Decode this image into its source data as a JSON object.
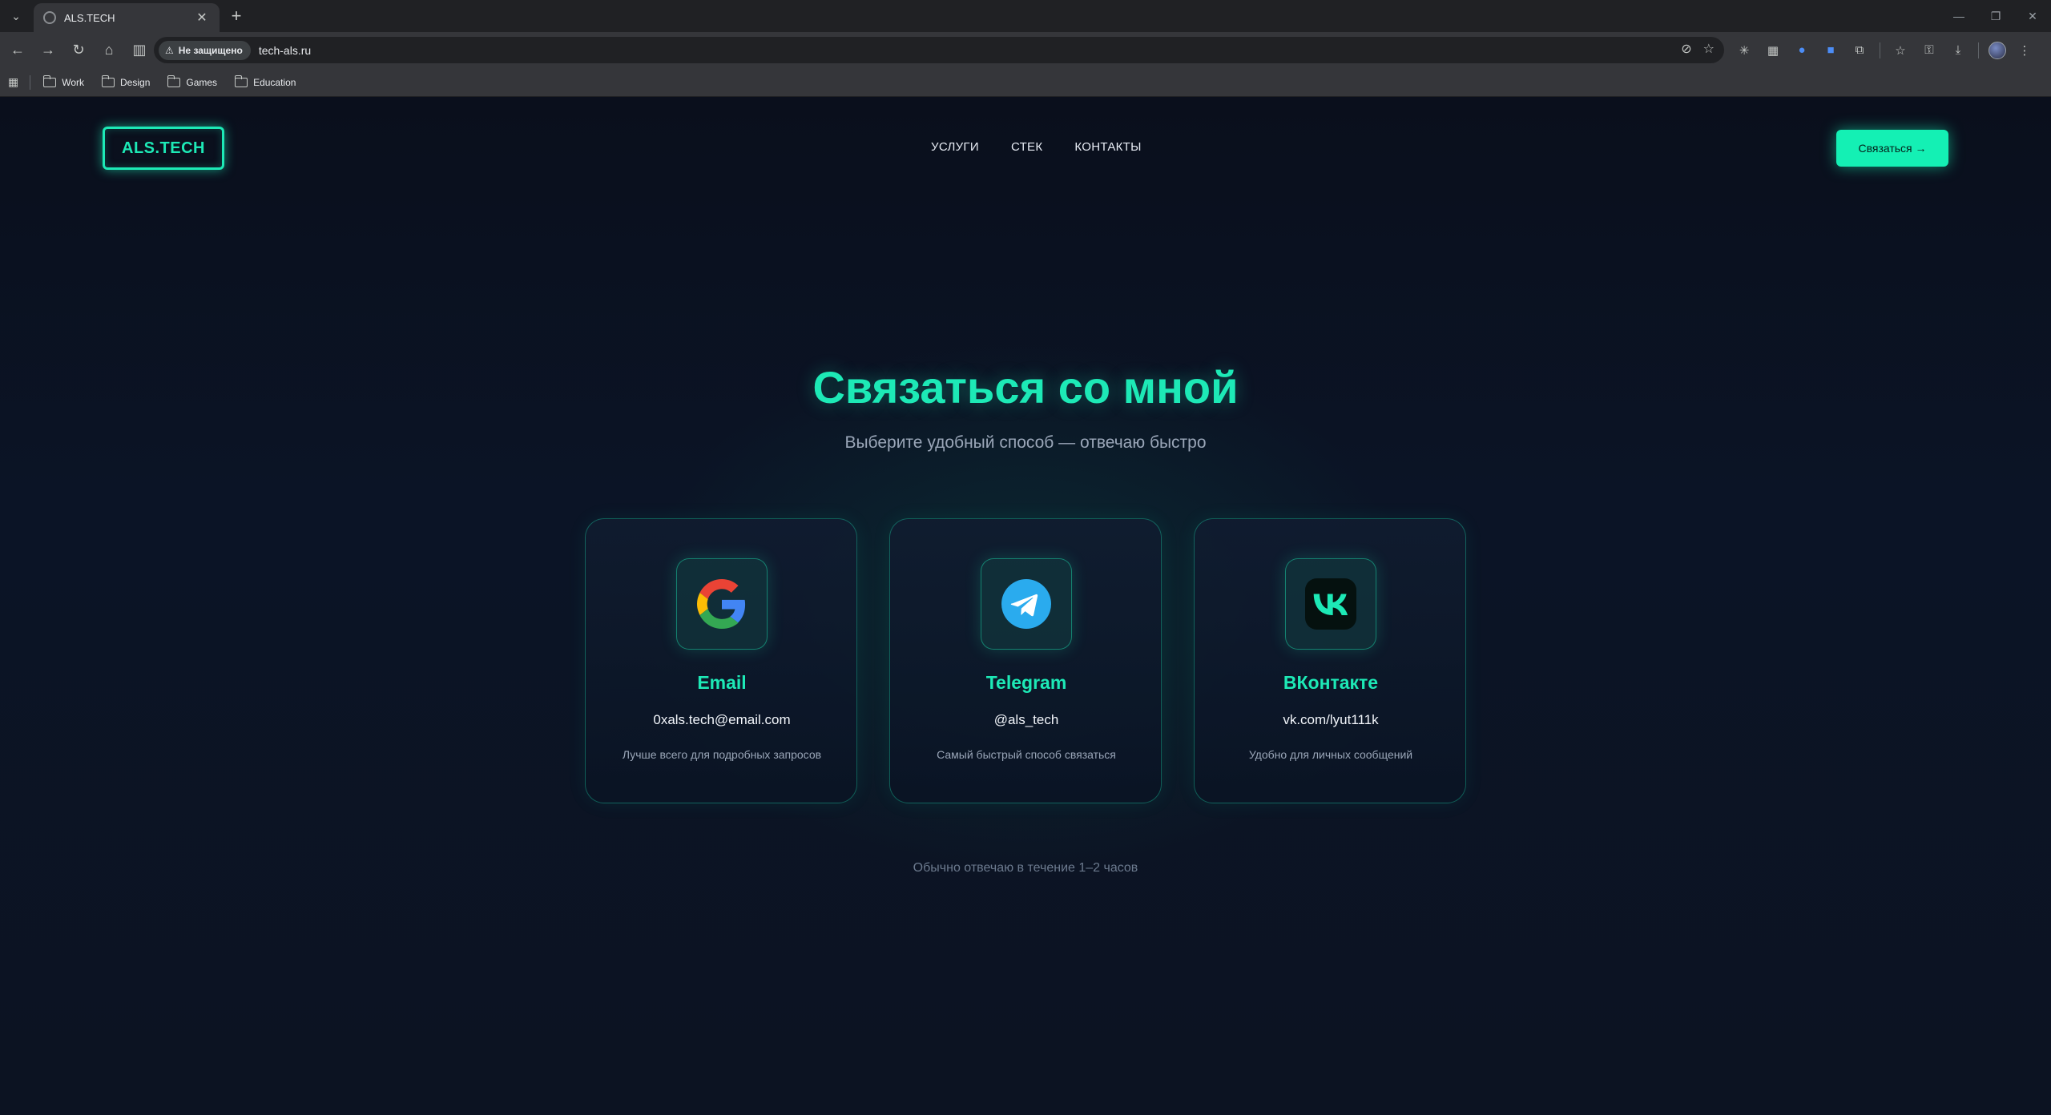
{
  "browser": {
    "tab_title": "ALS.TECH",
    "security_label": "Не защищено",
    "url": "tech-als.ru",
    "bookmarks": [
      "Work",
      "Design",
      "Games",
      "Education"
    ]
  },
  "header": {
    "logo": "ALS.TECH",
    "nav": [
      "УСЛУГИ",
      "СТЕК",
      "КОНТАКТЫ"
    ],
    "cta": "Связаться →"
  },
  "hero": {
    "title": "Связаться со мной",
    "subtitle": "Выберите удобный способ — отвечаю быстро"
  },
  "cards": [
    {
      "title": "Email",
      "value": "0xals.tech@email.com",
      "desc": "Лучше всего для подробных запросов",
      "icon": "google-icon"
    },
    {
      "title": "Telegram",
      "value": "@als_tech",
      "desc": "Самый быстрый способ связаться",
      "icon": "telegram-icon"
    },
    {
      "title": "ВКонтакте",
      "value": "vk.com/lyut111k",
      "desc": "Удобно для личных сообщений",
      "icon": "vk-icon"
    }
  ],
  "note": "Обычно отвечаю в течение 1–2 часов",
  "colors": {
    "accent": "#1de9b6",
    "cta": "#14f0b4",
    "background": "#0b1020"
  }
}
